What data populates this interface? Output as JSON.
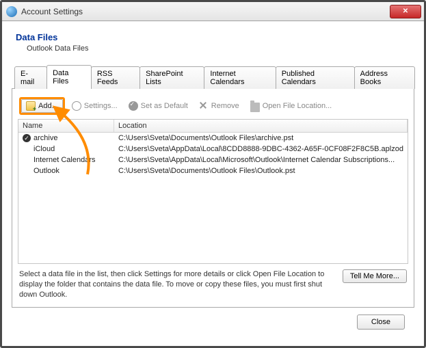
{
  "window": {
    "title": "Account Settings"
  },
  "section": {
    "title": "Data Files",
    "subtitle": "Outlook Data Files"
  },
  "tabs": [
    {
      "label": "E-mail"
    },
    {
      "label": "Data Files"
    },
    {
      "label": "RSS Feeds"
    },
    {
      "label": "SharePoint Lists"
    },
    {
      "label": "Internet Calendars"
    },
    {
      "label": "Published Calendars"
    },
    {
      "label": "Address Books"
    }
  ],
  "active_tab_index": 1,
  "toolbar": {
    "add": "Add...",
    "settings": "Settings...",
    "set_default": "Set as Default",
    "remove": "Remove",
    "open_location": "Open File Location..."
  },
  "columns": {
    "name": "Name",
    "location": "Location"
  },
  "rows": [
    {
      "default": true,
      "name": "archive",
      "location": "C:\\Users\\Sveta\\Documents\\Outlook Files\\archive.pst"
    },
    {
      "default": false,
      "name": "iCloud",
      "location": "C:\\Users\\Sveta\\AppData\\Local\\8CDD8888-9DBC-4362-A65F-0CF08F2F8C5B.aplzod"
    },
    {
      "default": false,
      "name": "Internet Calendars",
      "location": "C:\\Users\\Sveta\\AppData\\Local\\Microsoft\\Outlook\\Internet Calendar Subscriptions..."
    },
    {
      "default": false,
      "name": "Outlook",
      "location": "C:\\Users\\Sveta\\Documents\\Outlook Files\\Outlook.pst"
    }
  ],
  "note": "Select a data file in the list, then click Settings for more details or click Open File Location to display the folder that contains the data file. To move or copy these files, you must first shut down Outlook.",
  "tell_me_more": "Tell Me More...",
  "close": "Close",
  "highlight_color": "#ff8c00"
}
